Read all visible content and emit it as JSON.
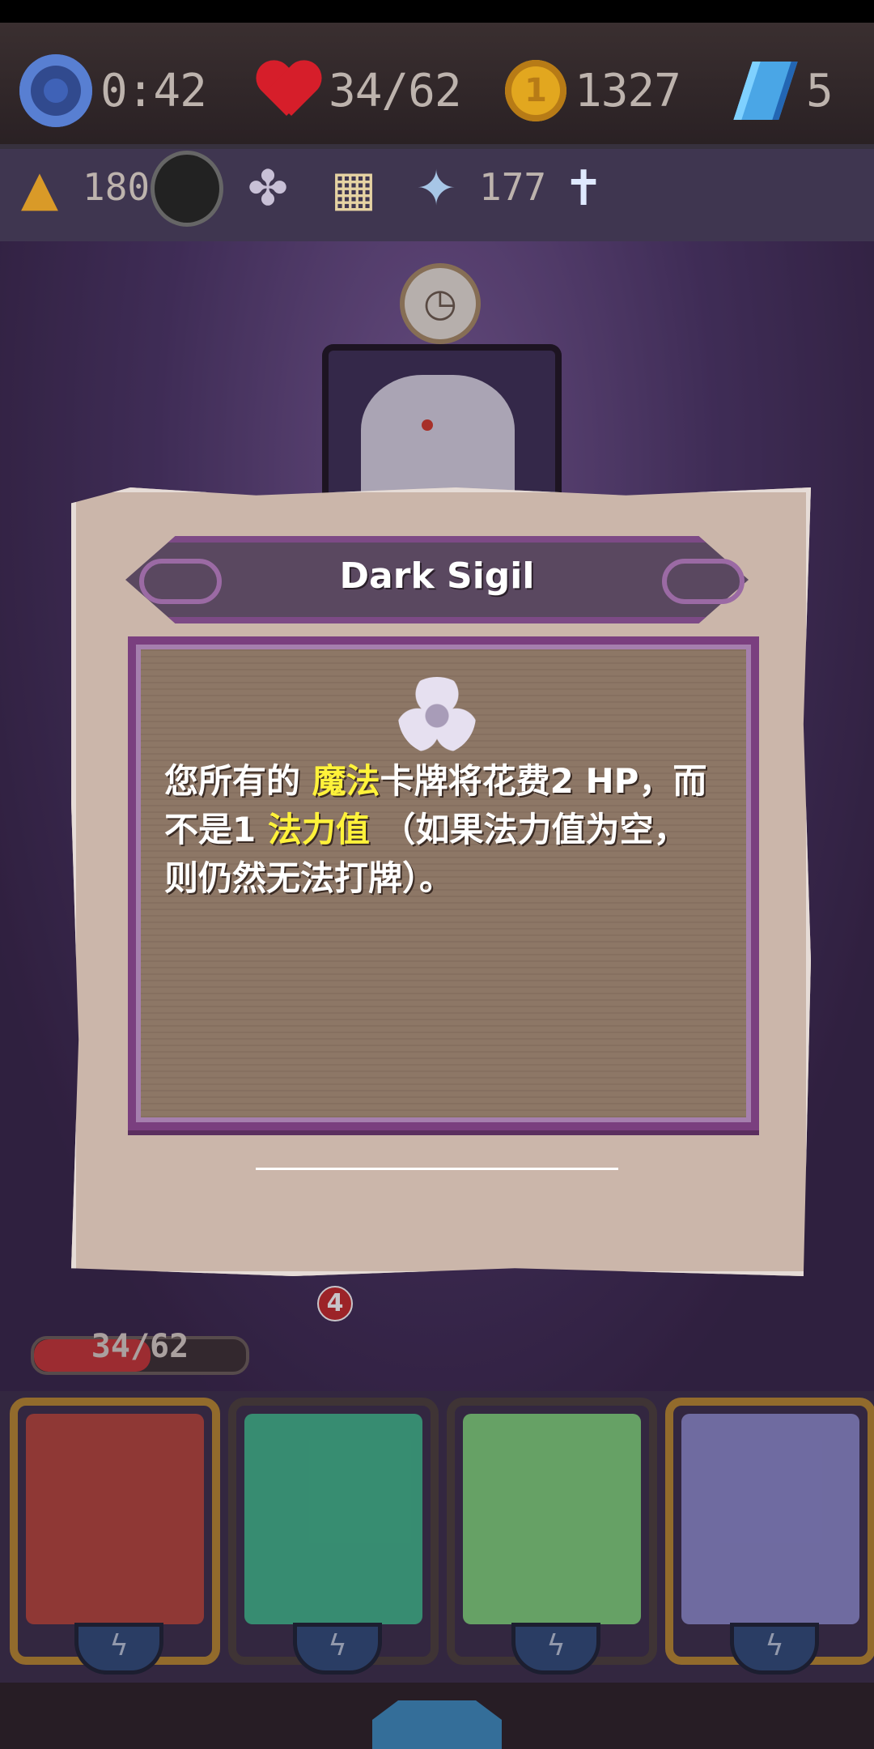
{
  "hud": {
    "timer": "0:42",
    "hp": "34/62",
    "gold": "1327",
    "gems": "5",
    "gold_coin_glyph": "1"
  },
  "relics": {
    "count_a": "180",
    "count_b": "177",
    "icons": [
      "wizard-hat-icon",
      "dark-orb-icon",
      "sigil-icon",
      "map-icon",
      "staff-icon",
      "holy-shrine-icon"
    ]
  },
  "popup": {
    "title": "Dark Sigil",
    "desc_part1": "您所有的 ",
    "desc_highlight1": "魔法",
    "desc_part2": "卡牌将花费2 HP，而不是1 ",
    "desc_highlight2": "法力值",
    "desc_part3": " （如果法力值为空，则仍然无法打牌）。"
  },
  "player": {
    "hp_text": "34/62",
    "hp_fraction": 0.548,
    "deck_count": "4"
  },
  "hand": {
    "cards": [
      {
        "name": "lion-sage-card",
        "color": "#b5453a"
      },
      {
        "name": "stone-golem-card",
        "color": "#3fb58a"
      },
      {
        "name": "leaf-slime-card",
        "color": "#7ed07a"
      },
      {
        "name": "red-mage-card",
        "color": "#8a88c9"
      }
    ]
  },
  "colors": {
    "highlight": "#fff23a",
    "frame_purple": "#7a3f7f"
  }
}
